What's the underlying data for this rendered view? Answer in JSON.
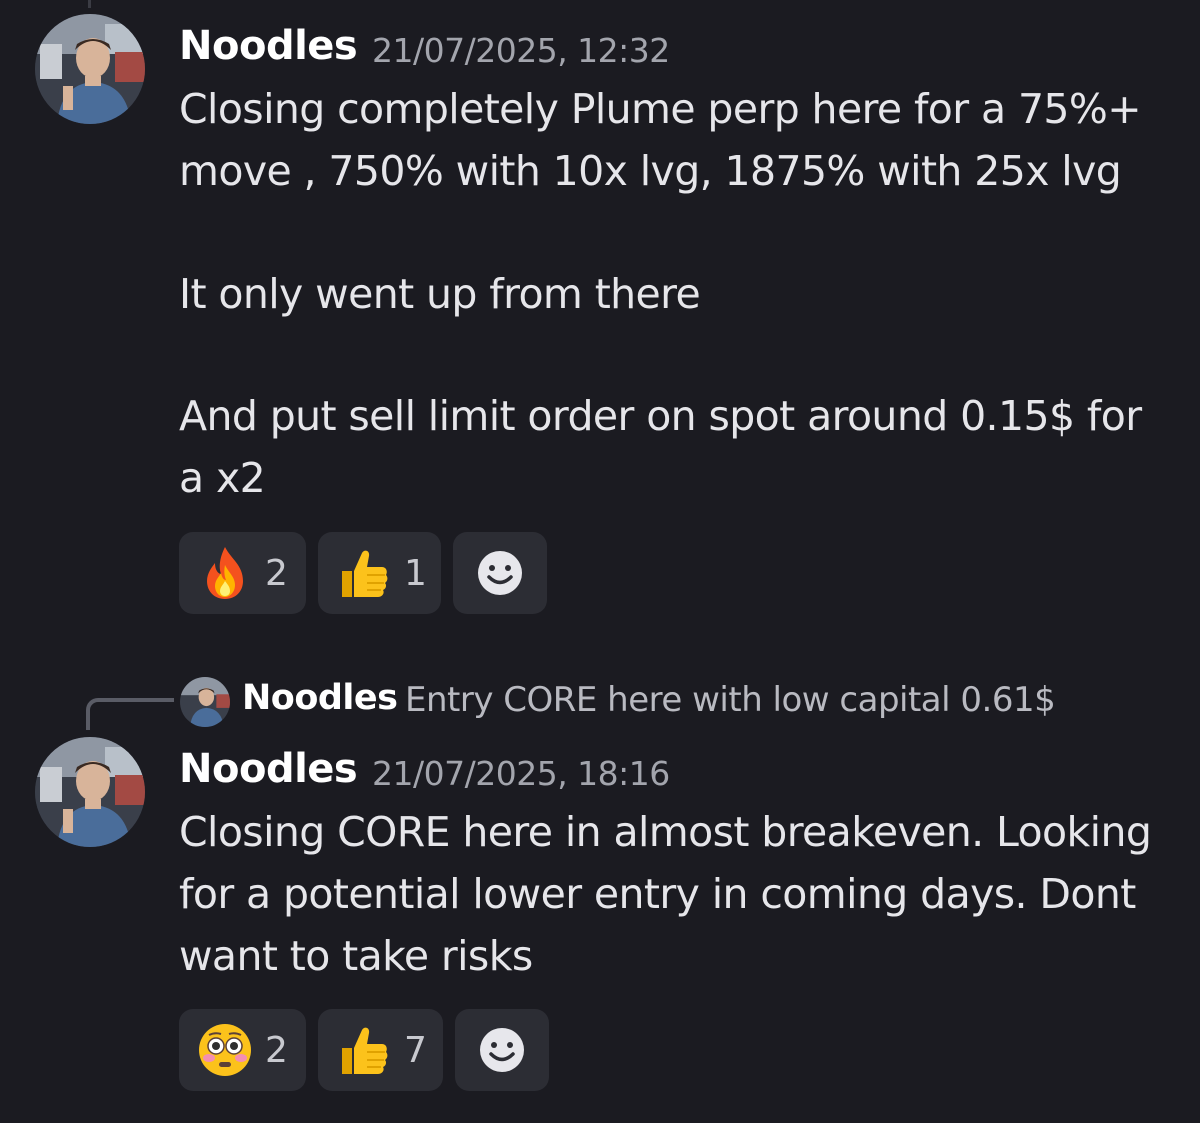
{
  "messages": [
    {
      "author": "Noodles",
      "timestamp": "21/07/2025, 12:32",
      "lines": [
        "Closing completely Plume perp here for a 75%+",
        "move , 750% with 10x lvg, 1875% with 25x lvg",
        "It only went up from there",
        "And put sell limit order on spot around 0.15$ for",
        "a x2"
      ],
      "reactions": [
        {
          "emoji": "fire-emoji",
          "count": "2"
        },
        {
          "emoji": "thumbs-up-emoji",
          "count": "1"
        }
      ]
    },
    {
      "author": "Noodles",
      "timestamp": "21/07/2025, 18:16",
      "reply": {
        "author": "Noodles",
        "text": "Entry CORE here with low capital 0.61$"
      },
      "lines": [
        "Closing CORE here in almost breakeven. Looking",
        "for a potential lower entry in coming days. Dont",
        "want to take risks"
      ],
      "reactions": [
        {
          "emoji": "flushed-face-emoji",
          "count": "2"
        },
        {
          "emoji": "thumbs-up-emoji",
          "count": "7"
        }
      ]
    }
  ],
  "colors": {
    "background": "#1b1b21",
    "reaction_bg": "#2c2d34",
    "timestamp": "#a3a5ad"
  }
}
